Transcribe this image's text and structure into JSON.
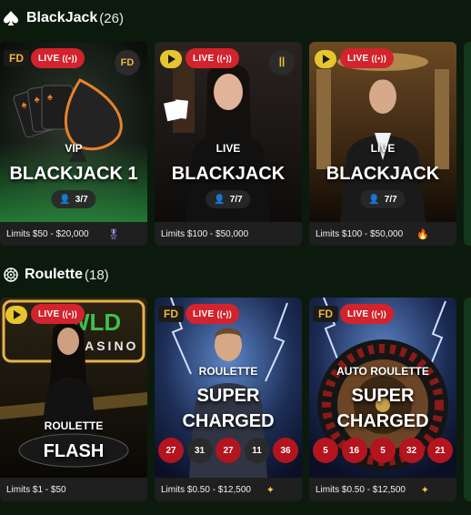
{
  "sections": {
    "blackjack": {
      "title": "BlackJack",
      "count": "(26)",
      "icon": "spade-icon",
      "cards": [
        {
          "provider": "FD",
          "live": "LIVE",
          "sub": "VIP",
          "name": "BLACKJACK 1",
          "players": "3/7",
          "limits": "Limits $50 - $20,000",
          "badge_icon": "vip-medal-icon"
        },
        {
          "provider": "play",
          "live": "LIVE",
          "sub": "LIVE",
          "name": "BLACKJACK",
          "players": "7/7",
          "limits": "Limits $100 - $50,000"
        },
        {
          "provider": "play",
          "live": "LIVE",
          "sub": "LIVE",
          "name": "BLACKJACK",
          "players": "7/7",
          "limits": "Limits $100 - $50,000",
          "badge_icon": "fire-icon"
        }
      ]
    },
    "roulette": {
      "title": "Roulette",
      "count": "(18)",
      "icon": "roulette-wheel-icon",
      "cards": [
        {
          "provider": "play",
          "live": "LIVE",
          "sub": "ROULETTE",
          "name": "FLASH",
          "limits": "Limits $1 - $50"
        },
        {
          "provider": "FD",
          "live": "LIVE",
          "sub": "ROULETTE",
          "name1": "SUPER",
          "name2": "CHARGED",
          "numbers": [
            "27",
            "31",
            "27",
            "11",
            "36"
          ],
          "limits": "Limits $0.50 - $12,500",
          "badge_icon": "sparkle-icon"
        },
        {
          "provider": "FD",
          "live": "LIVE",
          "sub": "AUTO ROULETTE",
          "name1": "SUPER",
          "name2": "CHARGED",
          "numbers": [
            "5",
            "16",
            "5",
            "32",
            "21"
          ],
          "limits": "Limits $0.50 - $12,500",
          "badge_icon": "sparkle-icon"
        }
      ]
    }
  },
  "colors": {
    "live_red": "#d3232c",
    "bg": "#0b1a0d",
    "limits_bar": "#1e1f1e",
    "number_red": "#b3141d",
    "number_black": "#2a2a2a"
  }
}
